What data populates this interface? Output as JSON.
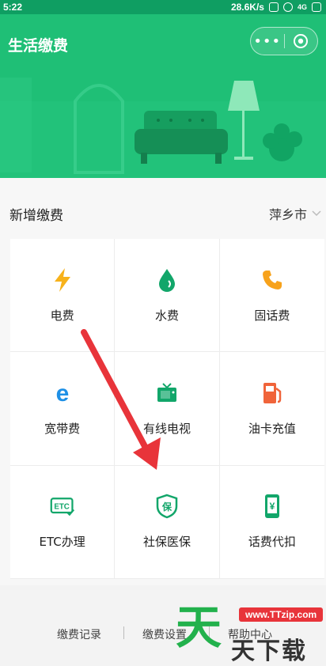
{
  "status_bar": {
    "time": "5:22",
    "network_speed": "28.6K/s",
    "network_type": "4G"
  },
  "header": {
    "title": "生活缴费",
    "menu_icon": "more-dots-icon",
    "close_icon": "target-icon",
    "brand_color": "#1fbf76"
  },
  "section": {
    "title": "新增缴费",
    "city": "萍乡市"
  },
  "services": [
    {
      "label": "电费",
      "icon": "lightning-icon"
    },
    {
      "label": "水费",
      "icon": "water-drop-icon"
    },
    {
      "label": "固话费",
      "icon": "phone-icon"
    },
    {
      "label": "宽带费",
      "icon": "browser-e-icon"
    },
    {
      "label": "有线电视",
      "icon": "tv-icon"
    },
    {
      "label": "油卡充值",
      "icon": "fuel-pump-icon"
    },
    {
      "label": "ETC办理",
      "icon": "etc-icon"
    },
    {
      "label": "社保医保",
      "icon": "insurance-shield-icon"
    },
    {
      "label": "话费代扣",
      "icon": "mobile-yuan-icon"
    }
  ],
  "footer": {
    "links": [
      "缴费记录",
      "缴费设置",
      "帮助中心"
    ]
  },
  "watermark": {
    "url": "www.TTzip.com",
    "text_main": "天",
    "text_rest": "天下载"
  }
}
